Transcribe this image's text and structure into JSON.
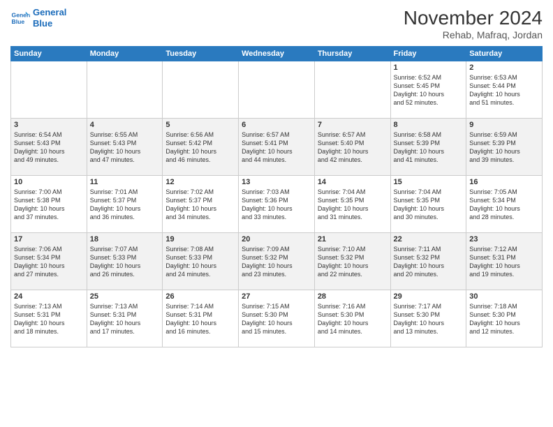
{
  "header": {
    "logo_line1": "General",
    "logo_line2": "Blue",
    "month": "November 2024",
    "location": "Rehab, Mafraq, Jordan"
  },
  "weekdays": [
    "Sunday",
    "Monday",
    "Tuesday",
    "Wednesday",
    "Thursday",
    "Friday",
    "Saturday"
  ],
  "weeks": [
    [
      {
        "day": "",
        "info": ""
      },
      {
        "day": "",
        "info": ""
      },
      {
        "day": "",
        "info": ""
      },
      {
        "day": "",
        "info": ""
      },
      {
        "day": "",
        "info": ""
      },
      {
        "day": "1",
        "info": "Sunrise: 6:52 AM\nSunset: 5:45 PM\nDaylight: 10 hours\nand 52 minutes."
      },
      {
        "day": "2",
        "info": "Sunrise: 6:53 AM\nSunset: 5:44 PM\nDaylight: 10 hours\nand 51 minutes."
      }
    ],
    [
      {
        "day": "3",
        "info": "Sunrise: 6:54 AM\nSunset: 5:43 PM\nDaylight: 10 hours\nand 49 minutes."
      },
      {
        "day": "4",
        "info": "Sunrise: 6:55 AM\nSunset: 5:43 PM\nDaylight: 10 hours\nand 47 minutes."
      },
      {
        "day": "5",
        "info": "Sunrise: 6:56 AM\nSunset: 5:42 PM\nDaylight: 10 hours\nand 46 minutes."
      },
      {
        "day": "6",
        "info": "Sunrise: 6:57 AM\nSunset: 5:41 PM\nDaylight: 10 hours\nand 44 minutes."
      },
      {
        "day": "7",
        "info": "Sunrise: 6:57 AM\nSunset: 5:40 PM\nDaylight: 10 hours\nand 42 minutes."
      },
      {
        "day": "8",
        "info": "Sunrise: 6:58 AM\nSunset: 5:39 PM\nDaylight: 10 hours\nand 41 minutes."
      },
      {
        "day": "9",
        "info": "Sunrise: 6:59 AM\nSunset: 5:39 PM\nDaylight: 10 hours\nand 39 minutes."
      }
    ],
    [
      {
        "day": "10",
        "info": "Sunrise: 7:00 AM\nSunset: 5:38 PM\nDaylight: 10 hours\nand 37 minutes."
      },
      {
        "day": "11",
        "info": "Sunrise: 7:01 AM\nSunset: 5:37 PM\nDaylight: 10 hours\nand 36 minutes."
      },
      {
        "day": "12",
        "info": "Sunrise: 7:02 AM\nSunset: 5:37 PM\nDaylight: 10 hours\nand 34 minutes."
      },
      {
        "day": "13",
        "info": "Sunrise: 7:03 AM\nSunset: 5:36 PM\nDaylight: 10 hours\nand 33 minutes."
      },
      {
        "day": "14",
        "info": "Sunrise: 7:04 AM\nSunset: 5:35 PM\nDaylight: 10 hours\nand 31 minutes."
      },
      {
        "day": "15",
        "info": "Sunrise: 7:04 AM\nSunset: 5:35 PM\nDaylight: 10 hours\nand 30 minutes."
      },
      {
        "day": "16",
        "info": "Sunrise: 7:05 AM\nSunset: 5:34 PM\nDaylight: 10 hours\nand 28 minutes."
      }
    ],
    [
      {
        "day": "17",
        "info": "Sunrise: 7:06 AM\nSunset: 5:34 PM\nDaylight: 10 hours\nand 27 minutes."
      },
      {
        "day": "18",
        "info": "Sunrise: 7:07 AM\nSunset: 5:33 PM\nDaylight: 10 hours\nand 26 minutes."
      },
      {
        "day": "19",
        "info": "Sunrise: 7:08 AM\nSunset: 5:33 PM\nDaylight: 10 hours\nand 24 minutes."
      },
      {
        "day": "20",
        "info": "Sunrise: 7:09 AM\nSunset: 5:32 PM\nDaylight: 10 hours\nand 23 minutes."
      },
      {
        "day": "21",
        "info": "Sunrise: 7:10 AM\nSunset: 5:32 PM\nDaylight: 10 hours\nand 22 minutes."
      },
      {
        "day": "22",
        "info": "Sunrise: 7:11 AM\nSunset: 5:32 PM\nDaylight: 10 hours\nand 20 minutes."
      },
      {
        "day": "23",
        "info": "Sunrise: 7:12 AM\nSunset: 5:31 PM\nDaylight: 10 hours\nand 19 minutes."
      }
    ],
    [
      {
        "day": "24",
        "info": "Sunrise: 7:13 AM\nSunset: 5:31 PM\nDaylight: 10 hours\nand 18 minutes."
      },
      {
        "day": "25",
        "info": "Sunrise: 7:13 AM\nSunset: 5:31 PM\nDaylight: 10 hours\nand 17 minutes."
      },
      {
        "day": "26",
        "info": "Sunrise: 7:14 AM\nSunset: 5:31 PM\nDaylight: 10 hours\nand 16 minutes."
      },
      {
        "day": "27",
        "info": "Sunrise: 7:15 AM\nSunset: 5:30 PM\nDaylight: 10 hours\nand 15 minutes."
      },
      {
        "day": "28",
        "info": "Sunrise: 7:16 AM\nSunset: 5:30 PM\nDaylight: 10 hours\nand 14 minutes."
      },
      {
        "day": "29",
        "info": "Sunrise: 7:17 AM\nSunset: 5:30 PM\nDaylight: 10 hours\nand 13 minutes."
      },
      {
        "day": "30",
        "info": "Sunrise: 7:18 AM\nSunset: 5:30 PM\nDaylight: 10 hours\nand 12 minutes."
      }
    ]
  ]
}
